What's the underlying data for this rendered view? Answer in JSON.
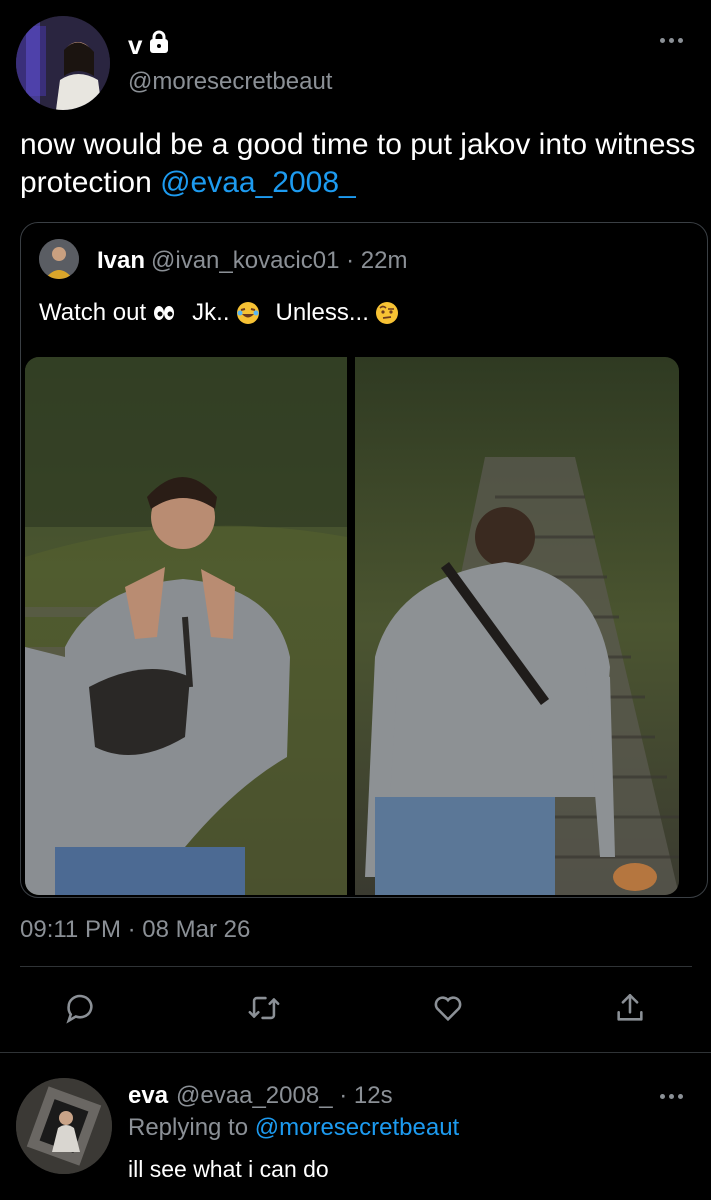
{
  "tweet": {
    "display_name": "v",
    "handle": "@moresecretbeaut",
    "text_before": "now would be a good time to put jakov into witness protection ",
    "mention": "@evaa_2008_",
    "timestamp": "09:11 PM · 08 Mar 26"
  },
  "quote": {
    "name": "Ivan",
    "meta": "@ivan_kovacic01 · 22m",
    "text": {
      "part1": "Watch out",
      "part2": "Jk..",
      "part3": "Unless..."
    }
  },
  "actions": [
    "reply-icon",
    "retweet-icon",
    "like-icon",
    "share-icon"
  ],
  "reply": {
    "name": "eva",
    "meta": "@evaa_2008_ · 12s",
    "replying_prefix": "Replying to ",
    "replying_handle": "@moresecretbeaut",
    "text": "ill see what i can do"
  },
  "colors": {
    "background": "#000000",
    "link": "#1d9bf0",
    "muted": "#8b9096",
    "text": "#ffffff"
  }
}
